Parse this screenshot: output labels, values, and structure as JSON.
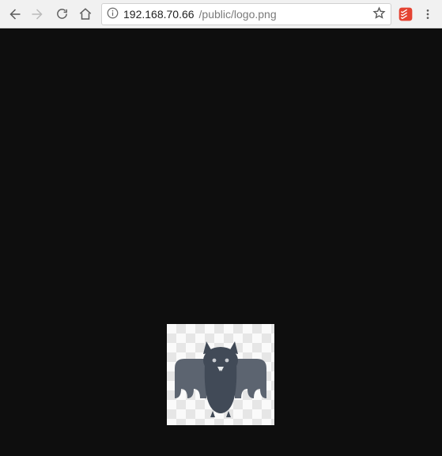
{
  "toolbar": {
    "back_tip": "Back",
    "forward_tip": "Forward",
    "reload_tip": "Reload",
    "home_tip": "Home",
    "info_tip": "View site information",
    "star_tip": "Bookmark this page",
    "menu_tip": "Menu"
  },
  "url": {
    "host": "192.168.70.66",
    "path": "/public/logo.png"
  },
  "image": {
    "name": "logo.png",
    "semantic": "bat-icon"
  },
  "colors": {
    "viewport_bg": "#0e0e0e",
    "toolbar_bg": "#f1f1f1",
    "bat_body": "#414a57",
    "bat_wing": "#5c6470",
    "todoist_red": "#e44332"
  }
}
